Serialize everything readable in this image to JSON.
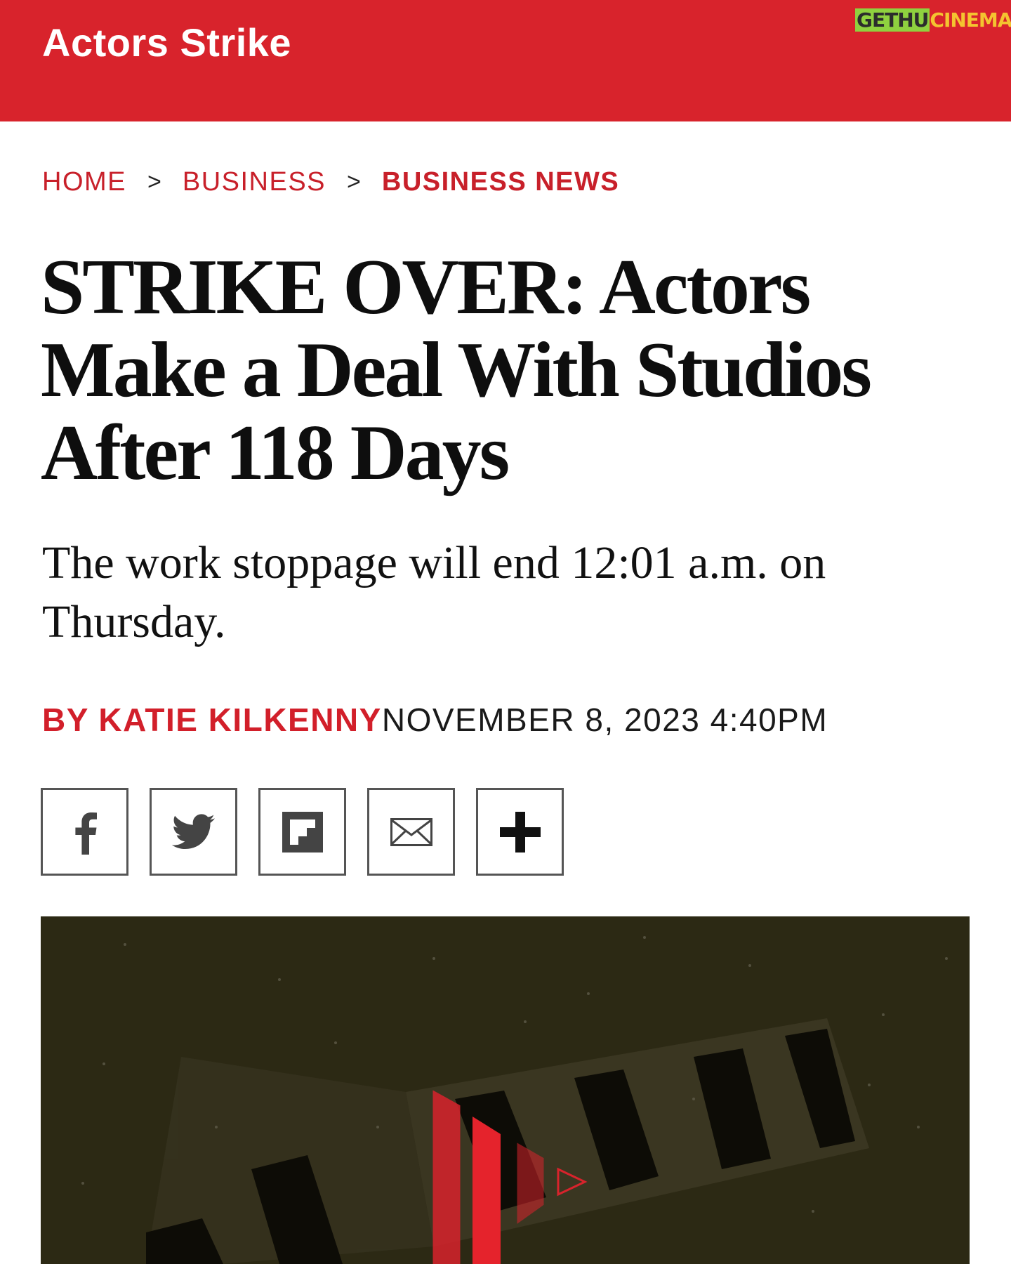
{
  "banner": {
    "section_title": "Actors Strike",
    "watermark": {
      "part1": "GETHU",
      "part2": "CINEMA"
    }
  },
  "breadcrumb": [
    {
      "label": "HOME"
    },
    {
      "label": "BUSINESS"
    },
    {
      "label": "BUSINESS NEWS"
    }
  ],
  "breadcrumb_separator": ">",
  "article": {
    "headline": "STRIKE OVER: Actors Make a Deal With Studios After 118 Days",
    "dek": "The work stoppage will end 12:01 a.m. on Thursday.",
    "byline": "BY KATIE KILKENNY",
    "date": "NOVEMBER 8, 2023 4:40PM"
  },
  "share_buttons": [
    {
      "icon": "facebook-icon"
    },
    {
      "icon": "twitter-icon"
    },
    {
      "icon": "flipboard-icon"
    },
    {
      "icon": "email-icon"
    },
    {
      "icon": "plus-icon"
    }
  ],
  "hero": {
    "icon": "play-video-icon"
  },
  "colors": {
    "brand_red": "#d8232c",
    "link_red": "#c8202a",
    "hero_bg": "#2c2914"
  }
}
